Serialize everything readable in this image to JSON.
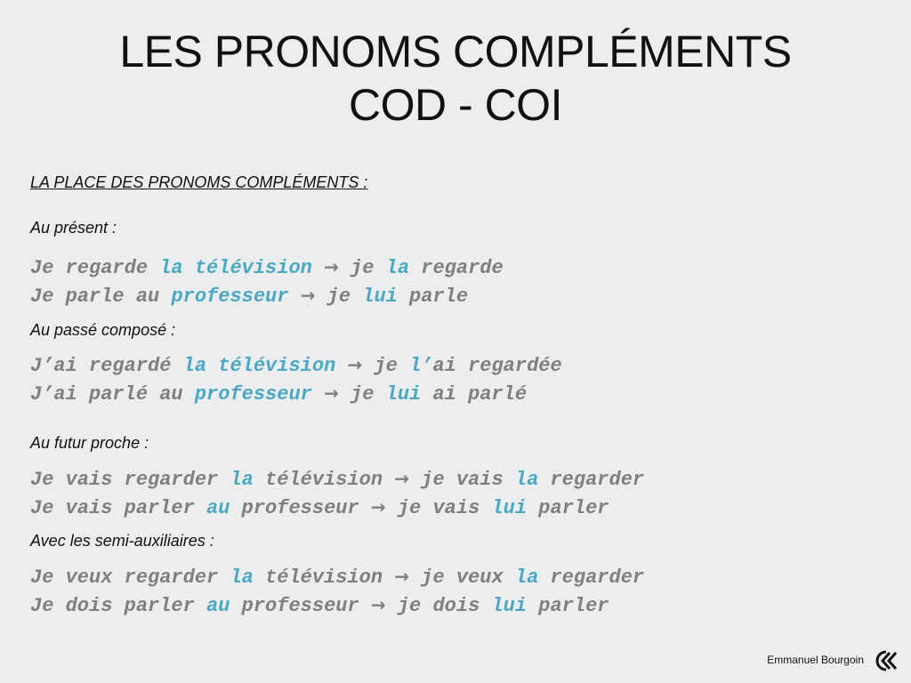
{
  "title": {
    "line1": "LES PRONOMS COMPLÉMENTS",
    "line2": "COD - COI"
  },
  "section_heading": "LA PLACE DES PRONOMS COMPLÉMENTS :",
  "arrow_glyph": "→",
  "sections": [
    {
      "label": "Au présent :",
      "examples": [
        {
          "p1": "Je regarde ",
          "h1": "la télévision",
          "p2": " ",
          "p3": " je ",
          "h2": "la",
          "p4": " regarde"
        },
        {
          "p1": "Je parle au ",
          "h1": "professeur",
          "p2": " ",
          "p3": " je ",
          "h2": "lui",
          "p4": " parle"
        }
      ]
    },
    {
      "label": "Au passé composé :",
      "examples": [
        {
          "p1": "J’ai regardé ",
          "h1": "la télévision",
          "p2": " ",
          "p3": " je ",
          "h2": "l’",
          "p4": "ai regardée"
        },
        {
          "p1": "J’ai parlé au ",
          "h1": "professeur",
          "p2": " ",
          "p3": " je ",
          "h2": "lui",
          "p4": " ai parlé"
        }
      ]
    },
    {
      "label": "Au futur proche :",
      "examples": [
        {
          "p1": "Je vais regarder ",
          "h1": "la",
          "p2": " télévision ",
          "p3": " je vais ",
          "h2": "la",
          "p4": " regarder"
        },
        {
          "p1": "Je vais parler ",
          "h1": "au",
          "p2": " professeur ",
          "p3": " je vais ",
          "h2": "lui",
          "p4": " parler"
        }
      ]
    },
    {
      "label": "Avec les semi-auxiliaires :",
      "examples": [
        {
          "p1": "Je veux regarder ",
          "h1": "la",
          "p2": " télévision ",
          "p3": " je veux ",
          "h2": "la",
          "p4": " regarder"
        },
        {
          "p1": "Je dois parler ",
          "h1": "au",
          "p2": " professeur ",
          "p3": " je dois ",
          "h2": "lui",
          "p4": " parler"
        }
      ]
    }
  ],
  "footer": {
    "author": "Emmanuel Bourgoin",
    "logo_icon": "ck-logo-icon"
  },
  "colors": {
    "background": "#ecedee",
    "highlight": "#4aa8c4",
    "example_text": "#7f7f7f",
    "text": "#111111"
  }
}
